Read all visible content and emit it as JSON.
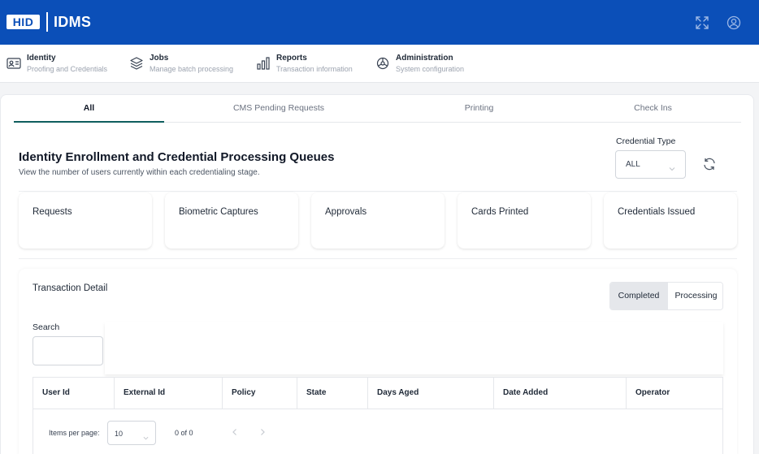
{
  "header": {
    "logo_text": "HID",
    "app_name": "IDMS",
    "icons": [
      "fullscreen-icon",
      "user-account-icon"
    ],
    "color": "#0b4fb8"
  },
  "nav": {
    "items": [
      {
        "title": "Identity",
        "subtitle": "Proofing and Credentials",
        "icon": "id-card-icon"
      },
      {
        "title": "Jobs",
        "subtitle": "Manage batch processing",
        "icon": "layers-icon"
      },
      {
        "title": "Reports",
        "subtitle": "Transaction information",
        "icon": "bar-chart-icon"
      },
      {
        "title": "Administration",
        "subtitle": "System configuration",
        "icon": "settings-wheel-icon"
      }
    ]
  },
  "tabs": [
    {
      "label": "All",
      "active": true
    },
    {
      "label": "CMS Pending Requests",
      "active": false
    },
    {
      "label": "Printing",
      "active": false
    },
    {
      "label": "Check Ins",
      "active": false
    }
  ],
  "queues": {
    "title": "Identity Enrollment and Credential Processing Queues",
    "subtitle": "View the number of users currently within each credentialing stage.",
    "credential_type": {
      "label": "Credential Type",
      "value": "ALL"
    },
    "cards": [
      {
        "label": "Requests"
      },
      {
        "label": "Biometric Captures"
      },
      {
        "label": "Approvals"
      },
      {
        "label": "Cards Printed"
      },
      {
        "label": "Credentials Issued"
      }
    ]
  },
  "transactions": {
    "title": "Transaction Detail",
    "toggle": {
      "selected": "Completed",
      "other": "Processing"
    },
    "search": {
      "label": "Search",
      "value": "",
      "placeholder": ""
    },
    "columns": [
      "User Id",
      "External Id",
      "Policy",
      "State",
      "Days Aged",
      "Date Added",
      "Operator"
    ],
    "pager": {
      "items_per_page_label": "Items per page:",
      "items_per_page": "10",
      "range": "0 of 0"
    }
  }
}
